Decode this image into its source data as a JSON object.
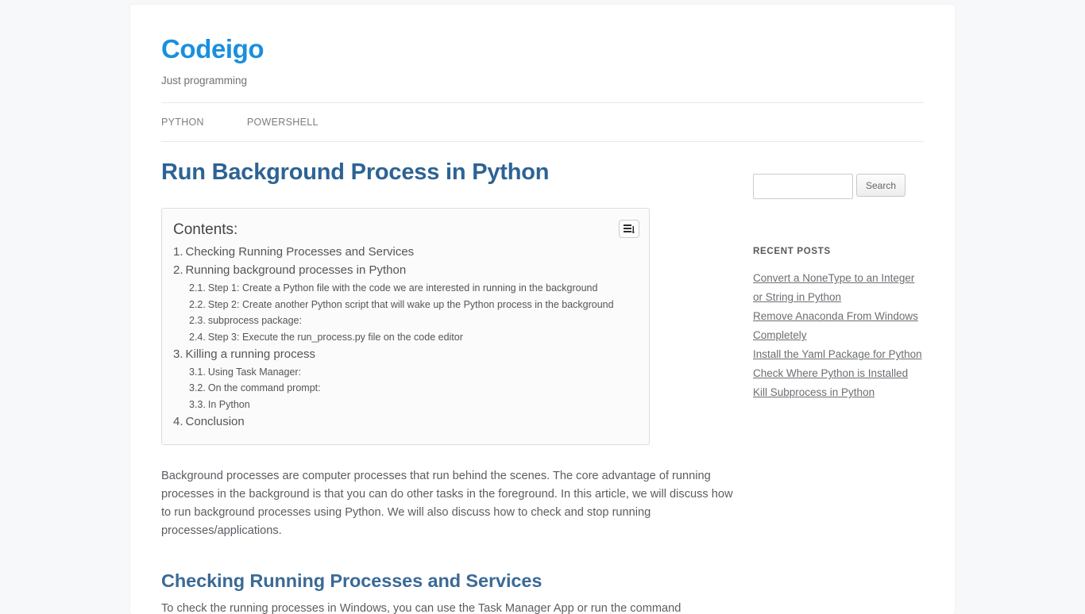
{
  "header": {
    "site_title": "Codeigo",
    "site_description": "Just programming",
    "title_color": "#1a8fdd"
  },
  "nav": {
    "items": [
      {
        "label": "PYTHON"
      },
      {
        "label": "POWERSHELL"
      }
    ]
  },
  "post": {
    "title": "Run Background Process in Python",
    "title_color": "#2d6394",
    "intro_paragraph": "Background processes are computer processes that run behind the scenes. The core advantage of running processes in the background is that you can do other tasks in the foreground. In this article, we will discuss how to run background processes using Python.  We will also discuss how to check and stop running processes/applications.",
    "section_heading": "Checking Running Processes and Services",
    "section_heading_color": "#3a6a96",
    "section_paragraph": "To check the running processes in Windows, you can use the Task Manager App or run the command"
  },
  "toc": {
    "heading": "Contents:",
    "toggle_icon": "list-toggle-icon",
    "items": [
      {
        "num": "1.",
        "label": "Checking Running Processes and Services",
        "level": 1
      },
      {
        "num": "2.",
        "label": "Running background processes in Python",
        "level": 1
      },
      {
        "num": "2.1.",
        "label": "Step 1: Create a Python file with the code we are interested in running in the background",
        "level": 2
      },
      {
        "num": "2.2.",
        "label": "Step 2: Create another Python script that will wake up the Python process in the background",
        "level": 2
      },
      {
        "num": "2.3.",
        "label": "subprocess package:",
        "level": 2
      },
      {
        "num": "2.4.",
        "label": "Step 3: Execute the run_process.py file on the code editor",
        "level": 2
      },
      {
        "num": "3.",
        "label": "Killing a running process",
        "level": 1
      },
      {
        "num": "3.1.",
        "label": "Using Task Manager:",
        "level": 2
      },
      {
        "num": "3.2.",
        "label": "On the command prompt:",
        "level": 2
      },
      {
        "num": "3.3.",
        "label": "In Python",
        "level": 2
      },
      {
        "num": "4.",
        "label": "Conclusion",
        "level": 1
      }
    ]
  },
  "sidebar": {
    "search": {
      "value": "",
      "placeholder": "",
      "button_label": "Search",
      "icon": "search-icon"
    },
    "recent_posts": {
      "title": "RECENT POSTS",
      "items": [
        {
          "label": "Convert a NoneType to an Integer or String in Python"
        },
        {
          "label": "Remove Anaconda From Windows Completely"
        },
        {
          "label": "Install the Yaml Package for Python"
        },
        {
          "label": "Check Where Python is Installed"
        },
        {
          "label": "Kill Subprocess in Python"
        }
      ]
    }
  }
}
